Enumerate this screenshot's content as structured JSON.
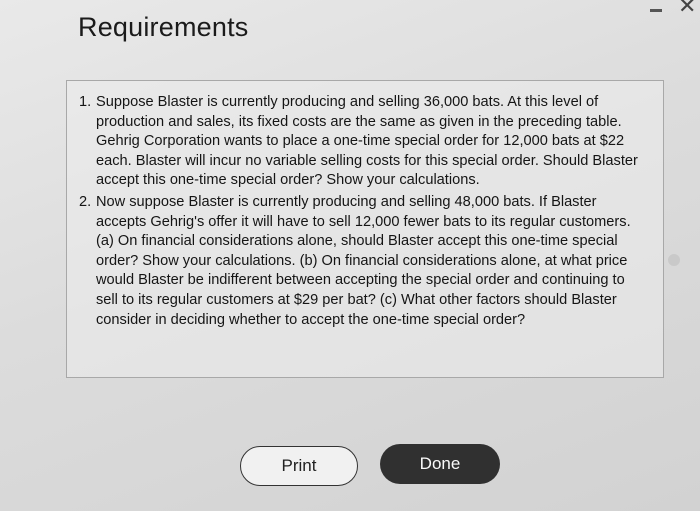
{
  "dialog": {
    "title": "Requirements",
    "window_controls": {
      "minimize_icon": "minimize-icon",
      "close_icon": "close-icon",
      "close_glyph": "✕"
    }
  },
  "requirements": [
    {
      "number": "1.",
      "text": "Suppose Blaster is currently producing and selling 36,000 bats. At this level of production and sales, its fixed costs are the same as given in the preceding table. Gehrig Corporation wants to place a one-time special order for 12,000 bats at $22 each. Blaster will incur no variable selling costs for this special order. Should Blaster accept this one-time special order? Show your calculations."
    },
    {
      "number": "2.",
      "text": "Now suppose Blaster is currently producing and selling 48,000 bats. If Blaster accepts Gehrig's offer it will have to sell 12,000 fewer bats to its regular customers. (a) On financial considerations alone, should Blaster accept this one-time special order? Show your calculations. (b) On financial considerations alone, at what price would Blaster be indifferent between accepting the special order and continuing to sell to its regular customers at $29 per bat? (c) What other factors should Blaster consider in deciding whether to accept the one-time special order?"
    }
  ],
  "buttons": {
    "print_label": "Print",
    "done_label": "Done"
  },
  "colors": {
    "done_button_bg": "#303030",
    "print_button_border": "#333333"
  }
}
